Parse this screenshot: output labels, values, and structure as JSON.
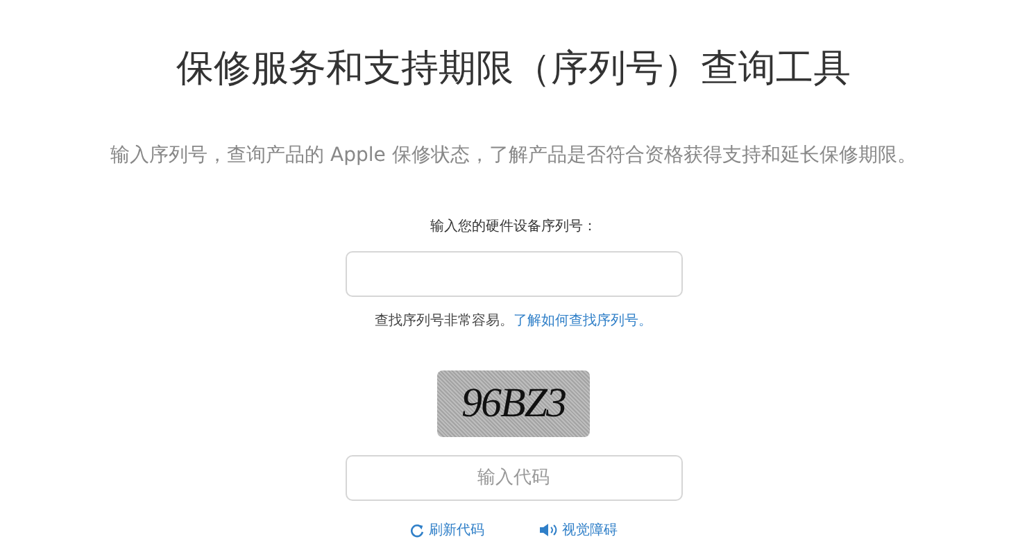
{
  "title": "保修服务和支持期限（序列号）查询工具",
  "subtitle": "输入序列号，查询产品的 Apple 保修状态，了解产品是否符合资格获得支持和延长保修期限。",
  "serial_field": {
    "label": "输入您的硬件设备序列号："
  },
  "hint": {
    "text": "查找序列号非常容易。",
    "link": "了解如何查找序列号。"
  },
  "captcha": "96BZ3",
  "code_field": {
    "placeholder": "输入代码"
  },
  "actions": [
    {
      "kind": "refresh",
      "label": "刷新代码"
    },
    {
      "kind": "audio",
      "label": "视觉障碍"
    }
  ]
}
